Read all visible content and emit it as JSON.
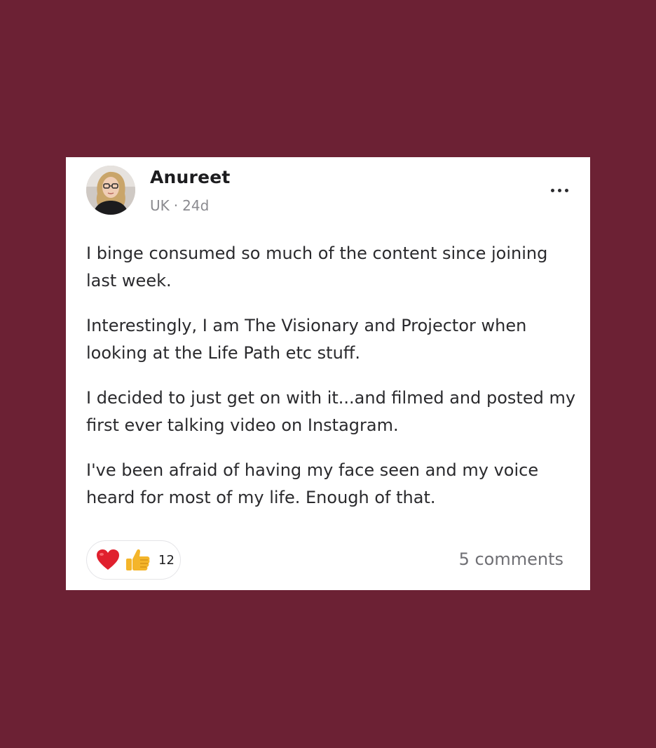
{
  "post": {
    "author": "Anureet",
    "location": "UK",
    "separator": "·",
    "age": "24d",
    "paragraphs": [
      "I binge consumed so much of the content since joining last week.",
      "Interestingly, I am The Visionary and Projector when looking at the Life Path etc stuff.",
      "I decided to just get on with it...and filmed and posted my first ever talking video on Instagram.",
      "I've been afraid of having my face seen and my voice heard for most of my life. Enough of that."
    ],
    "reactions": {
      "icons": [
        "heart-icon",
        "thumbs-up-icon"
      ],
      "count": "12"
    },
    "comments_label": "5 comments"
  },
  "colors": {
    "background": "#6c2134",
    "card": "#ffffff",
    "meta_text": "#8a8a8f",
    "heart": "#e0202e",
    "thumb": "#f4b52a"
  }
}
